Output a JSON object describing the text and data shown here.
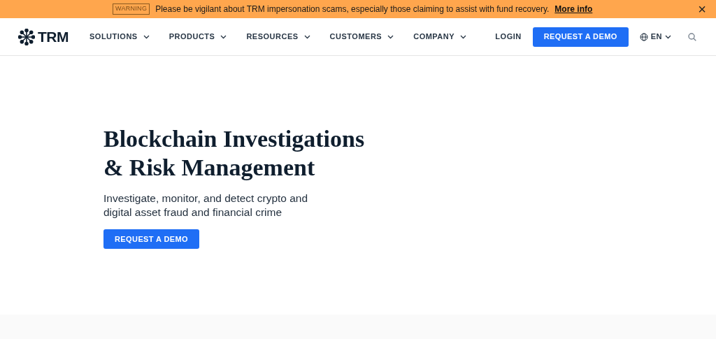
{
  "banner": {
    "tag": "WARNING",
    "message": "Please be vigilant about TRM impersonation scams, especially those claiming to assist with fund recovery.",
    "link": "More info",
    "close": "×"
  },
  "navbar": {
    "logo": "TRM",
    "menu": [
      {
        "label": "SOLUTIONS"
      },
      {
        "label": "PRODUCTS"
      },
      {
        "label": "RESOURCES"
      },
      {
        "label": "CUSTOMERS"
      },
      {
        "label": "COMPANY"
      }
    ],
    "login": "LOGIN",
    "cta": "REQUEST A DEMO",
    "language": "EN"
  },
  "hero": {
    "headline": "Blockchain Investigations & Risk Management",
    "subtitle": "Investigate, monitor, and detect crypto and digital asset fraud and financial crime",
    "cta": "REQUEST A DEMO"
  }
}
